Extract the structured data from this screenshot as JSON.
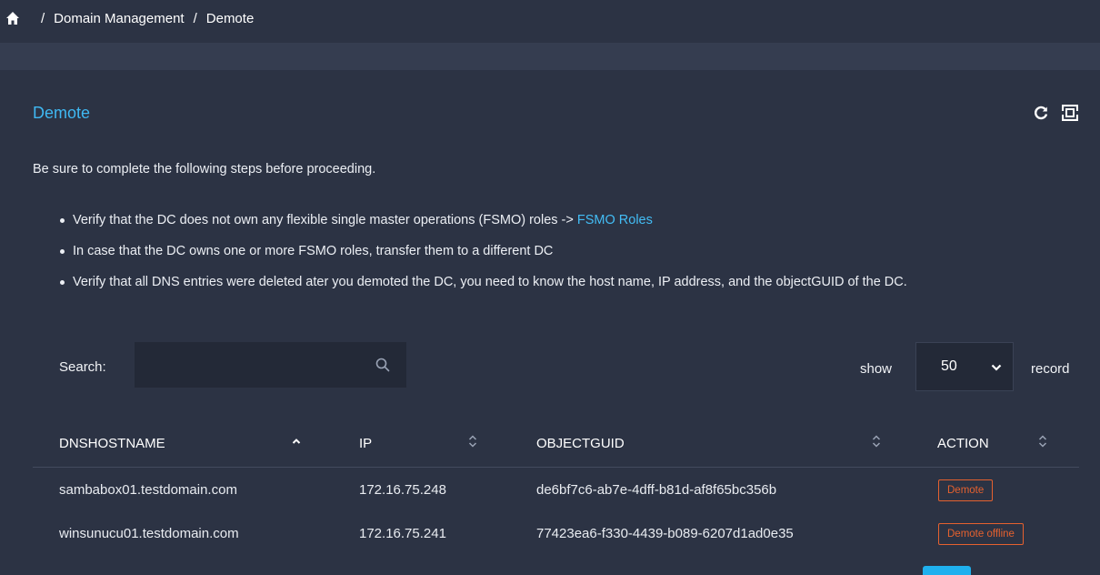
{
  "breadcrumb": {
    "items": [
      "Domain Management",
      "Demote"
    ],
    "separator": "/"
  },
  "panel": {
    "title": "Demote",
    "intro": "Be sure to complete the following steps before proceeding.",
    "steps": {
      "step1_text": "Verify that the DC does not own any flexible single master operations (FSMO) roles -> ",
      "step1_link": "FSMO Roles",
      "step2_text": "In case that the DC owns one or more FSMO roles, transfer them to a different DC",
      "step3_text": "Verify that all DNS entries were deleted ater you demoted the DC, you need to know the host name, IP address, and the objectGUID of the DC."
    }
  },
  "table_controls": {
    "search_label": "Search:",
    "search_value": "",
    "show_label": "show",
    "page_size": "50",
    "record_label": "record"
  },
  "table": {
    "columns": [
      "DNSHOSTNAME",
      "IP",
      "OBJECTGUID",
      "ACTION"
    ],
    "rows": [
      {
        "hostname": "sambabox01.testdomain.com",
        "ip": "172.16.75.248",
        "guid": "de6bf7c6-ab7e-4dff-b81d-af8f65bc356b",
        "action": "Demote"
      },
      {
        "hostname": "winsunucu01.testdomain.com",
        "ip": "172.16.75.241",
        "guid": "77423ea6-f330-4439-b089-6207d1ad0e35",
        "action": "Demote offline"
      }
    ]
  },
  "colors": {
    "background": "#2c3344",
    "accent": "#3fb8f2",
    "danger": "#e5612f"
  },
  "icons": [
    "home-icon",
    "refresh-icon",
    "fullscreen-icon",
    "search-icon",
    "chevron-down-icon",
    "sort-icon"
  ]
}
